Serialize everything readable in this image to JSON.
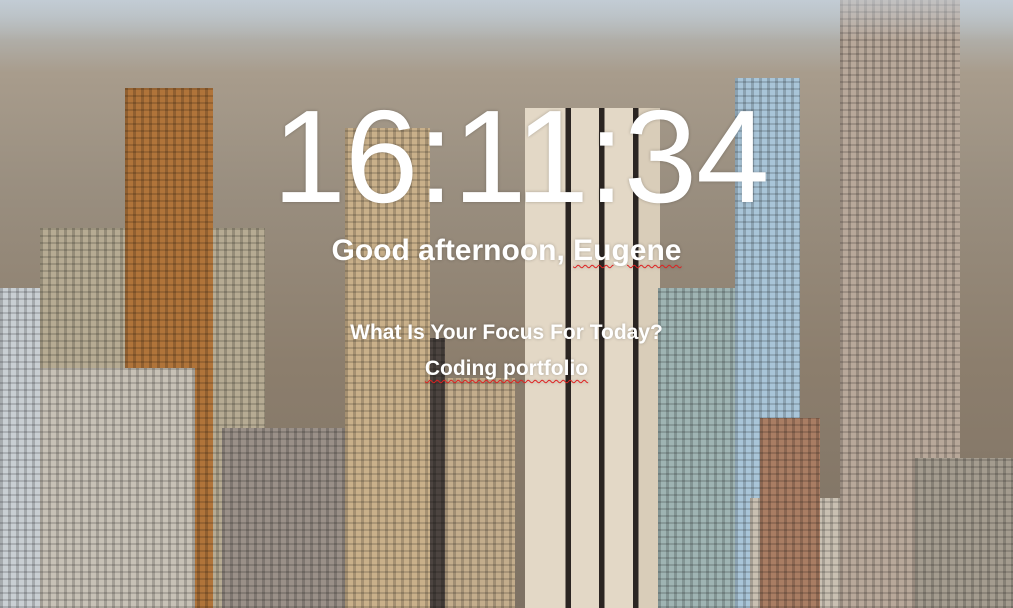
{
  "clock": {
    "time": "16:11:34"
  },
  "greeting": {
    "prefix": "Good afternoon, ",
    "name": "Eugene"
  },
  "focus": {
    "question": "What Is Your Focus For Today?",
    "value": "Coding portfolio"
  },
  "colors": {
    "text": "#ffffff",
    "spellcheck": "#e02020"
  }
}
